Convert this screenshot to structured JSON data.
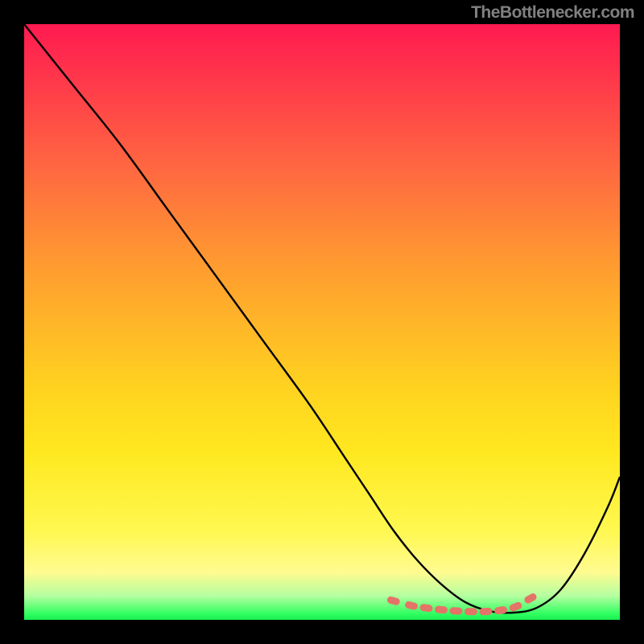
{
  "source_label": "TheBottlenecker.com",
  "colors": {
    "bg_page": "#000000",
    "curve": "#000000",
    "marker_fill": "#e47468",
    "marker_stroke": "#d85a4e",
    "gradient_top": "#ff1a50",
    "gradient_bottom": "#1aee50"
  },
  "chart_data": {
    "type": "line",
    "title": "",
    "xlabel": "",
    "ylabel": "",
    "xlim": [
      0,
      100
    ],
    "ylim": [
      0,
      100
    ],
    "series": [
      {
        "name": "curve",
        "x": [
          0,
          8,
          16,
          24,
          32,
          40,
          48,
          54,
          58,
          62,
          66,
          70,
          74,
          78,
          82,
          86,
          90,
          94,
          98,
          100
        ],
        "values": [
          100,
          90,
          80,
          69,
          58,
          47,
          36,
          27,
          21,
          15,
          10,
          6,
          3,
          1.5,
          1.2,
          2,
          5,
          11,
          19,
          24
        ]
      }
    ],
    "markers": {
      "comment": "dotted pink marker band near the trough, plotted on the curve",
      "x": [
        62,
        65,
        67.5,
        70,
        72.5,
        75,
        77.5,
        80,
        82.5,
        85
      ],
      "values": [
        3.2,
        2.4,
        2.0,
        1.7,
        1.5,
        1.4,
        1.4,
        1.6,
        2.2,
        3.6
      ]
    }
  }
}
